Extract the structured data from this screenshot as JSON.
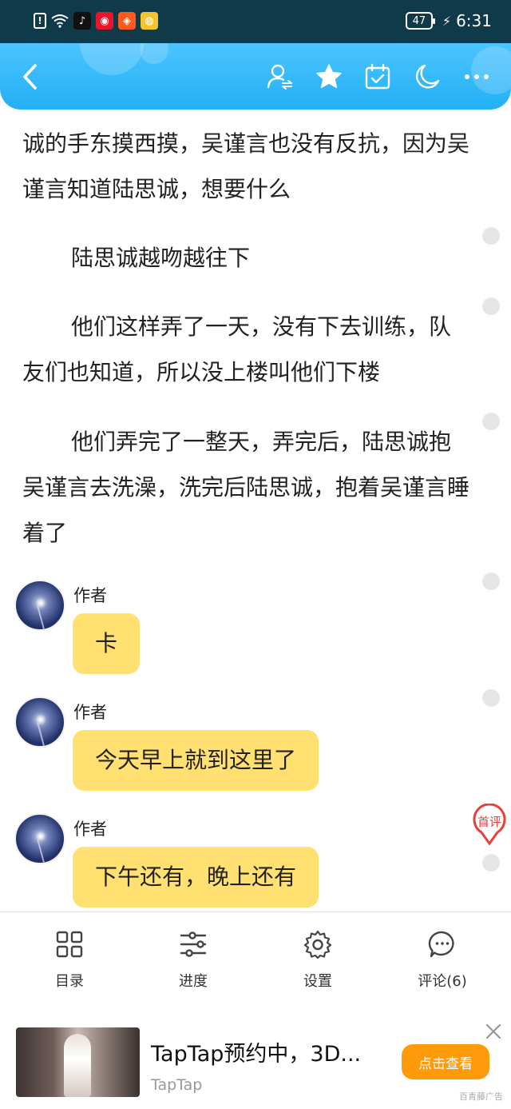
{
  "status_bar": {
    "battery": "47",
    "time": "6:31",
    "icons": [
      "alert-icon",
      "wifi-icon",
      "tiktok-icon",
      "weibo-icon",
      "app-icon",
      "wechat-icon"
    ]
  },
  "header": {
    "icons": [
      "back-icon",
      "author-switch-icon",
      "star-icon",
      "calendar-check-icon",
      "moon-icon",
      "more-icon"
    ],
    "accent": "#23b0f5"
  },
  "content": {
    "paragraphs": [
      "诚的手东摸西摸，吴谨言也没有反抗，因为吴谨言知道陆思诚，想要什么",
      "陆思诚越吻越往下",
      "他们这样弄了一天，没有下去训练，队友们也知道，所以没上楼叫他们下楼",
      "他们弄完了一整天，弄完后，陆思诚抱吴谨言去洗澡，洗完后陆思诚，抱着吴谨言睡着了"
    ],
    "messages": [
      {
        "name": "作者",
        "text": "卡"
      },
      {
        "name": "作者",
        "text": "今天早上就到这里了"
      },
      {
        "name": "作者",
        "text": "下午还有，晚上还有"
      }
    ],
    "first_comment_label": "首评",
    "bubble_color": "#ffe071"
  },
  "bottom_nav": {
    "items": [
      {
        "label": "目录",
        "icon": "grid-icon"
      },
      {
        "label": "进度",
        "icon": "sliders-icon"
      },
      {
        "label": "设置",
        "icon": "gear-icon"
      },
      {
        "label": "评论(6)",
        "icon": "comment-icon"
      }
    ]
  },
  "ad": {
    "title": "TapTap预约中，3D...",
    "source": "TapTap",
    "button": "点击查看",
    "brand": "百青藤广告",
    "button_color": "#ff9a0b"
  }
}
